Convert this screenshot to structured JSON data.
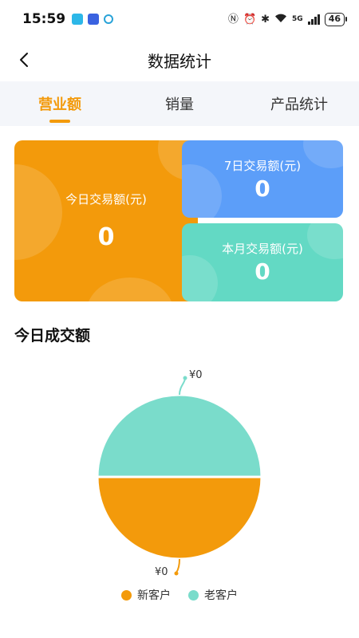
{
  "status_bar": {
    "time": "15:59",
    "network": "5G",
    "battery": "46"
  },
  "header": {
    "title": "数据统计"
  },
  "tabs": [
    {
      "label": "营业额",
      "active": true
    },
    {
      "label": "销量",
      "active": false
    },
    {
      "label": "产品统计",
      "active": false
    }
  ],
  "cards": {
    "today": {
      "label": "今日交易额(元)",
      "value": "0"
    },
    "week": {
      "label": "7日交易额(元)",
      "value": "0"
    },
    "month": {
      "label": "本月交易额(元)",
      "value": "0"
    }
  },
  "section": {
    "title": "今日成交额"
  },
  "chart_data": {
    "type": "pie",
    "categories": [
      "新客户",
      "老客户"
    ],
    "values": [
      0,
      0
    ],
    "value_labels": [
      "¥0",
      "¥0"
    ],
    "colors": [
      "#f39a0b",
      "#7adccb"
    ]
  },
  "colors": {
    "accent": "#f39a0b",
    "blue": "#5c9ef9",
    "teal": "#63d9c4",
    "tab_bg": "#f4f6fa"
  }
}
